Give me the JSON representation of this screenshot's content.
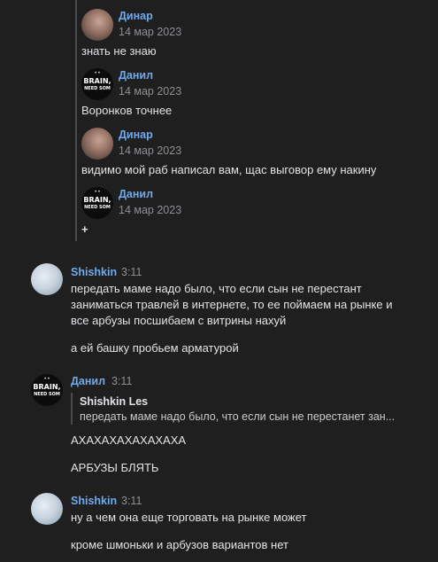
{
  "thread": {
    "replies": [
      {
        "author": "Динар",
        "date": "14 мар 2023",
        "text": "знать не знаю"
      },
      {
        "author": "Данил",
        "date": "14 мар 2023",
        "text": "Воронков точнее"
      },
      {
        "author": "Динар",
        "date": "14 мар 2023",
        "text": "видимо мой раб написал вам, щас выговор ему накину"
      },
      {
        "author": "Данил",
        "date": "14 мар 2023",
        "text": "+"
      }
    ]
  },
  "avatar_text": {
    "brain": "BRAIN,",
    "need": "NEED SOM"
  },
  "messages": [
    {
      "author": "Shishkin",
      "time": "3:11",
      "lines": [
        "передать маме надо было, что если сын не перестант",
        "заниматься травлей в интернете, то ее поймаем на рынке и",
        "все арбузы посшибаем с витрины нахуй"
      ],
      "extra": "а ей башку пробьем арматурой"
    },
    {
      "author": "Данил",
      "time": "3:11",
      "reply": {
        "author": "Shishkin Les",
        "text": "передать маме надо было, что если сын не перестанет зан..."
      },
      "lines": [
        "АХАХАХАХАХАХАХА"
      ],
      "extra": "АРБУЗЫ БЛЯТЬ"
    },
    {
      "author": "Shishkin",
      "time": "3:11",
      "lines": [
        "ну а чем она еще торговать на рынке может"
      ],
      "extra": "кроме шмоньки и арбузов вариантов нет"
    }
  ]
}
